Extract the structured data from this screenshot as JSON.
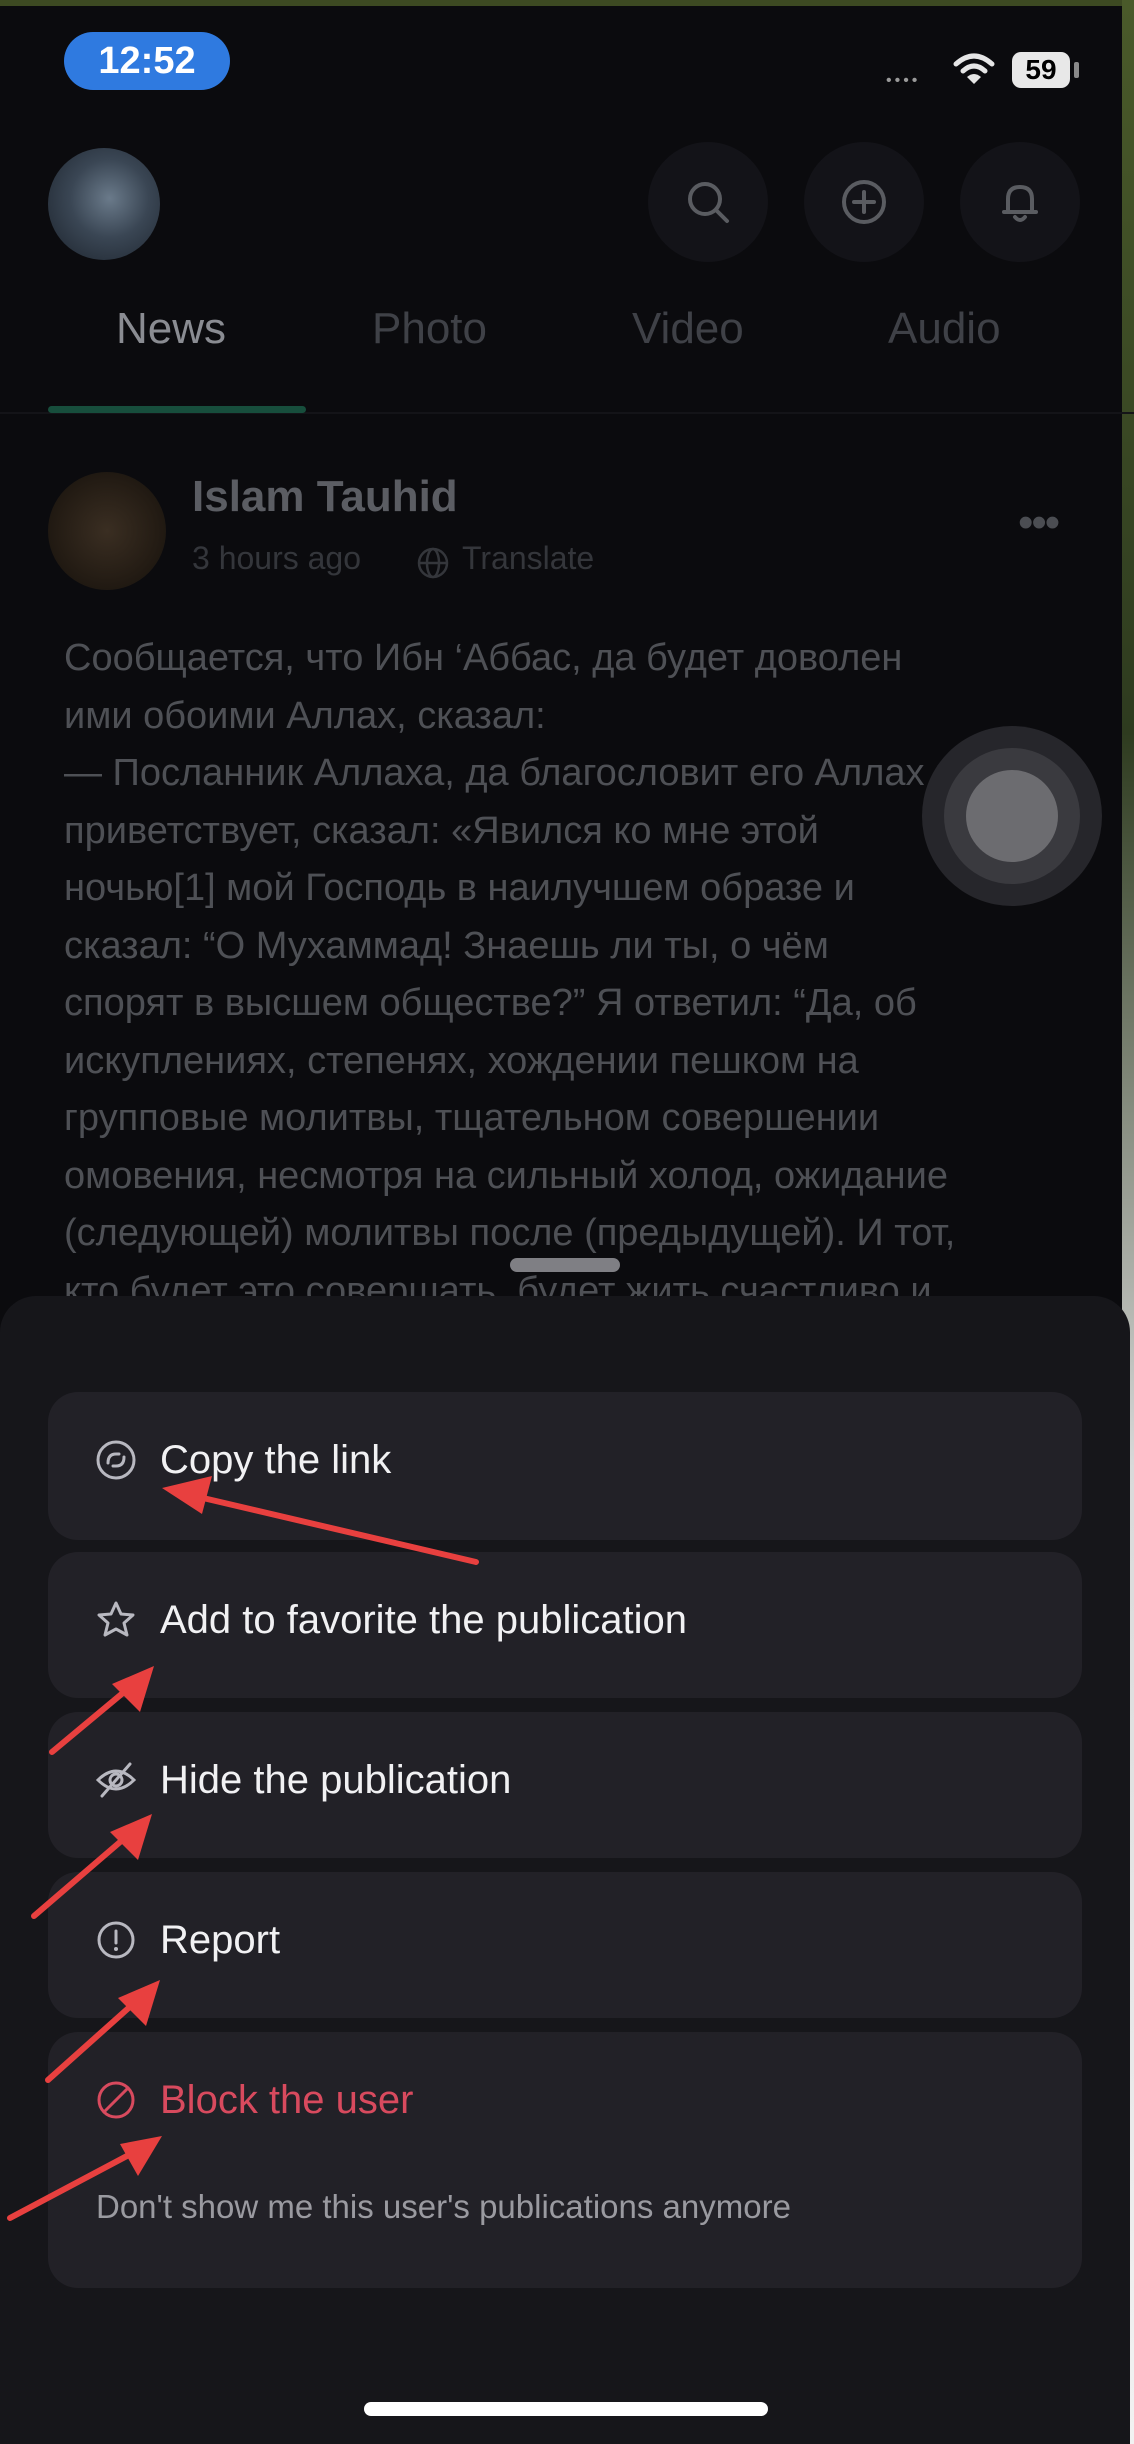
{
  "status_bar": {
    "time": "12:52",
    "signal_dots": "••••",
    "battery": "59"
  },
  "header": {
    "avatar": "profile-avatar",
    "icons": [
      "search-icon",
      "plus-circle-icon",
      "bell-icon"
    ]
  },
  "tabs": [
    {
      "label": "News",
      "active": true
    },
    {
      "label": "Photo",
      "active": false
    },
    {
      "label": "Video",
      "active": false
    },
    {
      "label": "Audio",
      "active": false
    }
  ],
  "post": {
    "author": "Islam Tauhid",
    "time_ago": "3 hours ago",
    "translate": "Translate",
    "more": "•••",
    "text": "Сообщается, что Ибн ‘Аббас, да будет доволен\nими обоими Аллах, сказал:\n— Посланник Аллаха, да благословит его Аллах и\nприветствует, сказал: «Явился ко мне этой\nночью[1] мой Господь в наилучшем образе и\nсказал: “О Мухаммад! Знаешь ли ты, о чём\nспорят в высшем обществе?” Я ответил: “Да, об\nискуплениях, степенях, хождении пешком на\nгрупповые молитвы, тщательном совершении\nомовения, несмотря на сильный холод, ожидание\n(следующей) молитвы после (предыдущей). И тот,\nкто будет это совершать, будет жить счастливо и"
  },
  "sheet": {
    "options": [
      {
        "label": "Copy the link",
        "icon": "link-icon"
      },
      {
        "label": "Add to favorite the publication",
        "icon": "star-icon"
      },
      {
        "label": "Hide the publication",
        "icon": "eye-off-icon"
      },
      {
        "label": "Report",
        "icon": "alert-circle-icon"
      },
      {
        "label": "Block the user",
        "icon": "block-icon",
        "sublabel": "Don't show me this user's publications anymore",
        "danger": true
      }
    ]
  },
  "colors": {
    "accent_tab": "#174e3c",
    "danger": "#d84a5e",
    "annotation_arrow": "#e8403f",
    "time_pill": "#2f7ae0"
  }
}
